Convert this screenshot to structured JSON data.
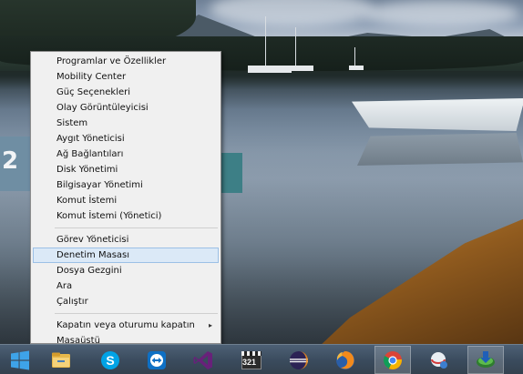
{
  "context_menu": {
    "items": [
      {
        "label": "Programlar ve Özellikler"
      },
      {
        "label": "Mobility Center"
      },
      {
        "label": "Güç Seçenekleri"
      },
      {
        "label": "Olay Görüntüleyicisi"
      },
      {
        "label": "Sistem"
      },
      {
        "label": "Aygıt Yöneticisi"
      },
      {
        "label": "Ağ Bağlantıları"
      },
      {
        "label": "Disk Yönetimi"
      },
      {
        "label": "Bilgisayar Yönetimi"
      },
      {
        "label": "Komut İstemi"
      },
      {
        "label": "Komut İstemi (Yönetici)"
      },
      {
        "label": "Görev Yöneticisi"
      },
      {
        "label": "Denetim Masası",
        "highlighted": true
      },
      {
        "label": "Dosya Gezgini"
      },
      {
        "label": "Ara"
      },
      {
        "label": "Çalıştır"
      },
      {
        "label": "Kapatın veya oturumu kapatın",
        "submenu": true
      },
      {
        "label": "Masaüstü"
      }
    ],
    "submenu_arrow": "▸"
  },
  "wallpaper": {
    "boat_number": "2"
  },
  "taskbar": {
    "items": [
      {
        "icon": "windows-logo-icon",
        "name": "start-button"
      },
      {
        "icon": "file-explorer-icon",
        "name": "taskbar-file-explorer"
      },
      {
        "icon": "skype-icon",
        "name": "taskbar-skype"
      },
      {
        "icon": "teamviewer-icon",
        "name": "taskbar-teamviewer"
      },
      {
        "icon": "visual-studio-icon",
        "name": "taskbar-visual-studio"
      },
      {
        "icon": "media-player-321-icon",
        "name": "taskbar-media-player"
      },
      {
        "icon": "eclipse-icon",
        "name": "taskbar-eclipse"
      },
      {
        "icon": "firefox-icon",
        "name": "taskbar-firefox"
      },
      {
        "icon": "chrome-icon",
        "name": "taskbar-chrome",
        "active": true
      },
      {
        "icon": "network-tool-icon",
        "name": "taskbar-network-tool"
      },
      {
        "icon": "download-manager-icon",
        "name": "taskbar-download-manager",
        "active": true
      }
    ],
    "media_player_badge": "321"
  },
  "colors": {
    "menu_bg": "#f0f0f0",
    "menu_highlight": "#dbe9f7",
    "taskbar": "#3a4b5d",
    "windows_logo": "#3ea3e8"
  }
}
